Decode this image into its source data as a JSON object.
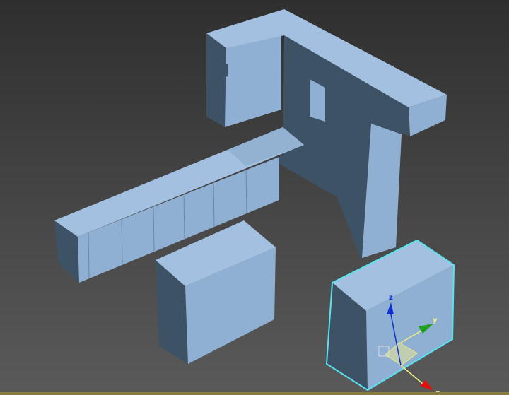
{
  "viewport": {
    "colors": {
      "top": "#a3c0e0",
      "front": "#8fb0d2",
      "dark": "#3e5266",
      "selection": "#57e3f0",
      "axis_x": "#e01010",
      "axis_y": "#20a020",
      "axis_z": "#1030d0",
      "plane": "#e8e890"
    },
    "gizmo": {
      "x_label": "x",
      "y_label": "y",
      "z_label": "z"
    }
  }
}
